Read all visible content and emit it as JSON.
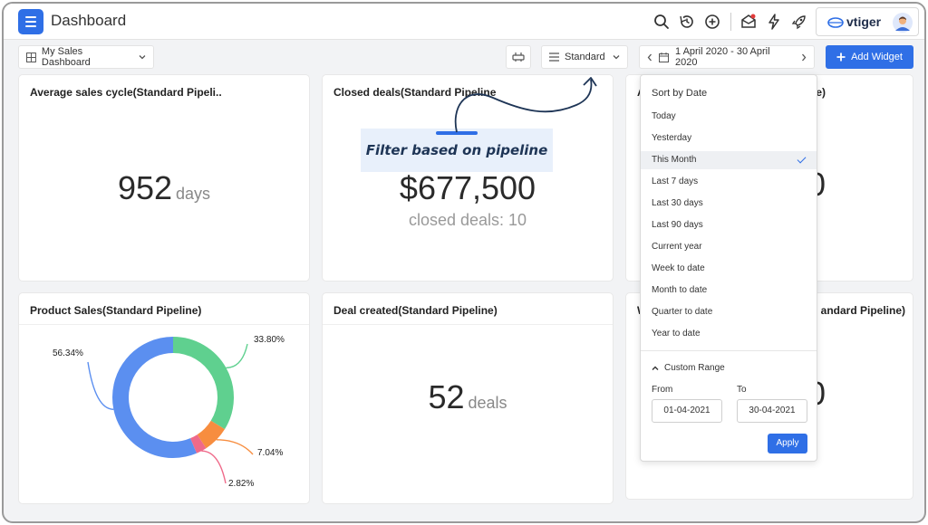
{
  "topbar": {
    "title": "Dashboard",
    "icons": [
      "search-icon",
      "history-icon",
      "add-circle-icon",
      "inbox-icon",
      "lightning-icon",
      "rocket-icon"
    ],
    "brand": "vtiger"
  },
  "toolbar": {
    "dashboard_select": "My Sales Dashboard",
    "pipeline_select": "Standard",
    "date_range": "1 April 2020 - 30 April 2020",
    "add_widget": "Add Widget"
  },
  "widgets": [
    {
      "title": "Average sales cycle(Standard Pipeli..",
      "value": "952",
      "unit": "days"
    },
    {
      "title": "Closed deals(Standard Pipeline",
      "value": "$677,500",
      "sub": "closed deals: 10"
    },
    {
      "title": "A",
      "title_tail": "e)",
      "value_tail": "0"
    },
    {
      "title": "Product Sales(Standard Pipeline)"
    },
    {
      "title": "Deal created(Standard Pipeline)",
      "value": "52",
      "unit": "deals"
    },
    {
      "title": "W",
      "title_tail": "andard Pipeline)",
      "value_tail": "0"
    }
  ],
  "chart_data": {
    "type": "pie",
    "title": "Product Sales(Standard Pipeline)",
    "labels": [
      "56.34%",
      "33.80%",
      "7.04%",
      "2.82%"
    ],
    "values": [
      56.34,
      33.8,
      7.04,
      2.82
    ],
    "colors": [
      "#5b8ff0",
      "#5fd08f",
      "#f78d3f",
      "#ef6a8a"
    ],
    "donut": true
  },
  "callout": {
    "text": "Filter based on pipeline"
  },
  "date_dropdown": {
    "header": "Sort by Date",
    "options": [
      "Today",
      "Yesterday",
      "This Month",
      "Last 7 days",
      "Last 30 days",
      "Last 90 days",
      "Current year",
      "Week to date",
      "Month to date",
      "Quarter to date",
      "Year to date"
    ],
    "selected": "This Month",
    "custom_range_label": "Custom Range",
    "from_label": "From",
    "to_label": "To",
    "from_value": "01-04-2021",
    "to_value": "30-04-2021",
    "apply_label": "Apply"
  },
  "colors": {
    "accent": "#2f6fe6",
    "background": "#f2f3f5"
  }
}
